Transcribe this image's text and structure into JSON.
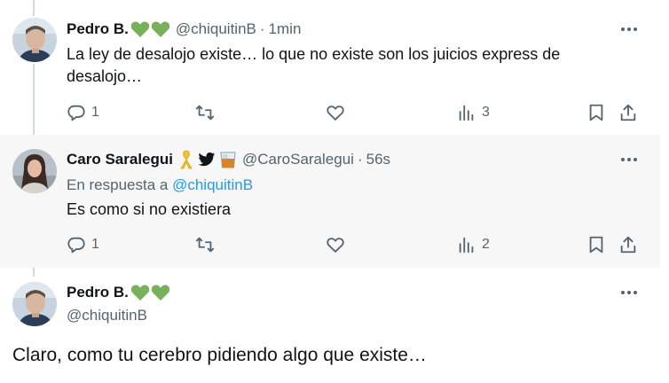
{
  "tweets": [
    {
      "name": "Pedro B.",
      "name_emojis": [
        "green-heart",
        "green-heart"
      ],
      "handle": "@chiquitinB",
      "separator": "·",
      "time": "1min",
      "text": "La ley de desalojo existe… lo que no existe son los juicios express de desalojo…",
      "reply_count": "1",
      "views": "3"
    },
    {
      "name": "Caro Saralegui",
      "name_emojis": [
        "yellow-ribbon",
        "twitter-bird",
        "whisky-glass"
      ],
      "handle": "@CaroSaralegui",
      "separator": "·",
      "time": "56s",
      "reply_prefix": "En respuesta a",
      "reply_handle": "@chiquitinB",
      "text": "Es como si no existiera",
      "reply_count": "1",
      "views": "2"
    }
  ],
  "main_tweet": {
    "name": "Pedro B.",
    "name_emojis": [
      "green-heart",
      "green-heart"
    ],
    "handle": "@chiquitinB",
    "text": "Claro, como tu cerebro pidiendo algo que existe…"
  },
  "colors": {
    "text": "#0f1419",
    "secondary": "#536471",
    "link": "#1d9bf0",
    "emoji_green": "#78b159",
    "highlight_bg": "#f7f7f7",
    "thread_line": "#cfd9de"
  }
}
